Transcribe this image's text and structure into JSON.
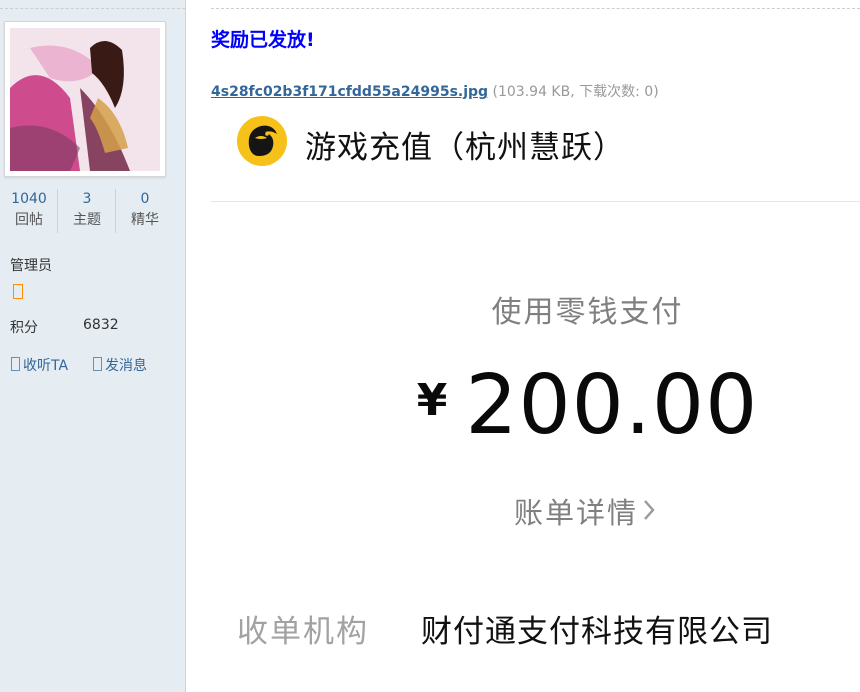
{
  "profile": {
    "stats": [
      {
        "value": "1040",
        "label": "回帖"
      },
      {
        "value": "3",
        "label": "主题"
      },
      {
        "value": "0",
        "label": "精华"
      }
    ],
    "usergroup": "管理员",
    "credits_label": "积分",
    "credits_value": "6832",
    "actions": {
      "follow": "收听TA",
      "message": "发消息"
    }
  },
  "post": {
    "reward_text": "奖励已发放!",
    "attachment": {
      "filename": "4s28fc02b3f171cfdd55a24995s.jpg",
      "meta": "(103.94 KB, 下载次数: 0)"
    }
  },
  "receipt": {
    "merchant": "游戏充值（杭州慧跃）",
    "pay_method": "使用零钱支付",
    "currency": "¥",
    "amount": "200.00",
    "bill_details": "账单详情",
    "acquirer_label": "收单机构",
    "acquirer_value": "财付通支付科技有限公司"
  },
  "colors": {
    "reward": "#0000ff",
    "link": "#336699",
    "sidebar_bg": "#e5edf2",
    "logo_bg": "#f6c21a"
  }
}
